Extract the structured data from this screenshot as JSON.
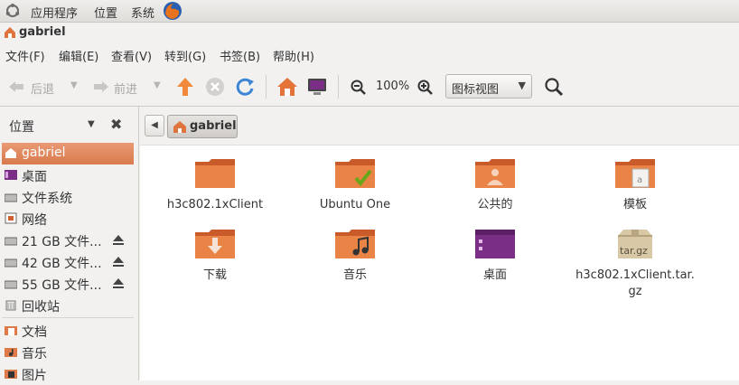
{
  "top_panel": {
    "apps": "应用程序",
    "places": "位置",
    "system": "系统"
  },
  "window": {
    "title": "gabriel"
  },
  "menubar": [
    "文件(F)",
    "编辑(E)",
    "查看(V)",
    "转到(G)",
    "书签(B)",
    "帮助(H)"
  ],
  "toolbar": {
    "back": "后退",
    "forward": "前进",
    "zoom": "100%",
    "view_mode": "图标视图"
  },
  "sidebar": {
    "header": "位置",
    "items": [
      "gabriel",
      "桌面",
      "文件系统",
      "网络",
      "21 GB 文件...",
      "42 GB 文件...",
      "55 GB 文件...",
      "回收站",
      "文档",
      "音乐",
      "图片"
    ]
  },
  "location": {
    "crumb": "gabriel"
  },
  "files": {
    "f1": "h3c802.1xClient",
    "f2": "Ubuntu One",
    "f3": "公共的",
    "f4": "模板",
    "f5": "下载",
    "f6": "音乐",
    "f7": "桌面",
    "f8a": "h3c802.1xClient.tar.",
    "f8b": "gz",
    "archive_badge": "tar.gz"
  },
  "colors": {
    "accent": "#dd7a47",
    "selection": "#e08a5e",
    "panel": "#f2f1f0"
  }
}
